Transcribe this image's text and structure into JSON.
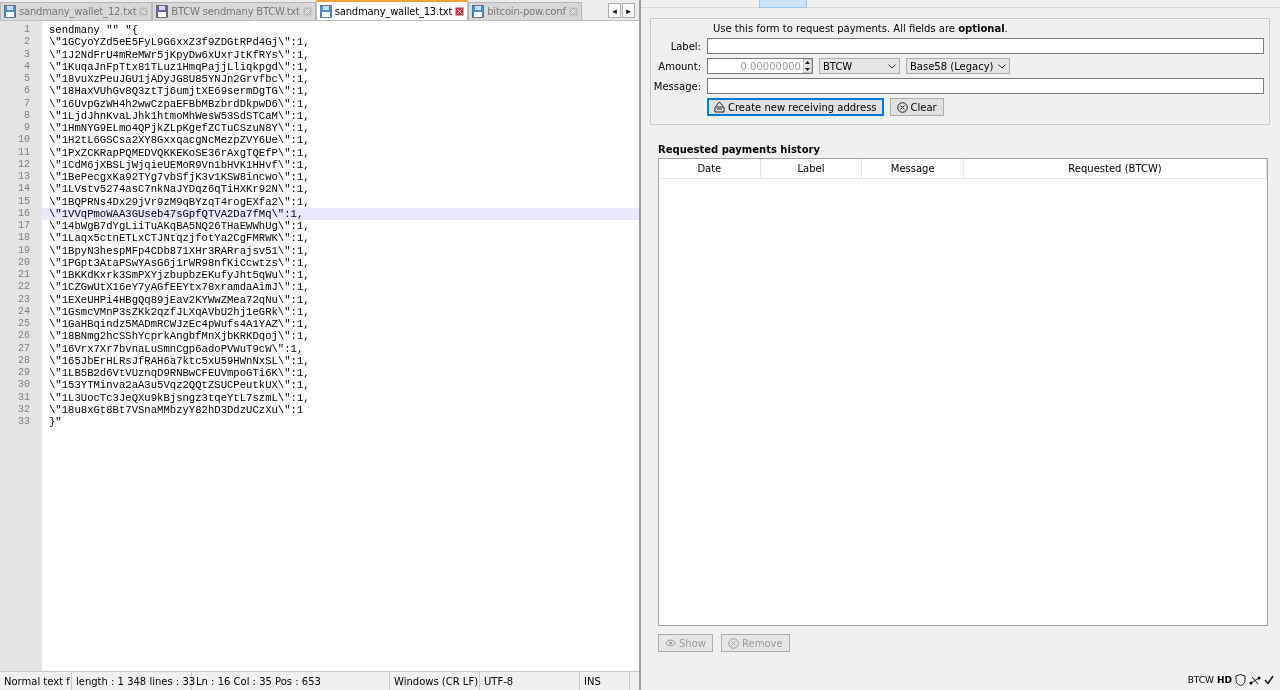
{
  "editor": {
    "tabs": [
      {
        "label": "sandmany_wallet_12.txt",
        "selected": false,
        "kind": "plain"
      },
      {
        "label": "BTCW sendmany BTCW.txt",
        "selected": false,
        "kind": "marked"
      },
      {
        "label": "sandmany_wallet_13.txt",
        "selected": true,
        "kind": "plain"
      },
      {
        "label": "bitcoin-pow.conf",
        "selected": false,
        "kind": "plain"
      }
    ],
    "scroll_buttons": [
      "◂",
      "▸"
    ],
    "lines": [
      {
        "number": "1",
        "text": "sendmany \"\" \"{",
        "selected": false
      },
      {
        "number": "2",
        "text": "\\\"1GCyoYZd5eE5FyL9G6xxZ3f9ZDGtRPd4Gj\\\":1,",
        "selected": false
      },
      {
        "number": "3",
        "text": "\\\"1J2NdFrU4mReMWr5jKpyDw6xUxrJtKfRYs\\\":1,",
        "selected": false
      },
      {
        "number": "4",
        "text": "\\\"1KuqaJnFpTtx81TLuz1HmqPajjLliqkpgd\\\":1,",
        "selected": false
      },
      {
        "number": "5",
        "text": "\\\"18vuXzPeuJGU1jADyJG8U85YNJn2Grvfbc\\\":1,",
        "selected": false
      },
      {
        "number": "6",
        "text": "\\\"18HaxVUhGv8Q3ztTj6umjtXE69sermDgTG\\\":1,",
        "selected": false
      },
      {
        "number": "7",
        "text": "\\\"16UvpGzWH4h2wwCzpaEFBbMBzbrdDkpwD6\\\":1,",
        "selected": false
      },
      {
        "number": "8",
        "text": "\\\"1LjdJhnKvaLJhk1htmoMhWesW53SdSTCaM\\\":1,",
        "selected": false
      },
      {
        "number": "9",
        "text": "\\\"1HmNYG9ELmo4QPjkZLpKgefZCTuCSzuN8Y\\\":1,",
        "selected": false
      },
      {
        "number": "10",
        "text": "\\\"1H2tL6GSCsa2XY8GxxqacgNcMezpZVY6Ue\\\":1,",
        "selected": false
      },
      {
        "number": "11",
        "text": "\\\"1PxZCKRapPQMEDVQKKEKoSE36rAxgTQEfP\\\":1,",
        "selected": false
      },
      {
        "number": "12",
        "text": "\\\"1CdM6jXBSLjWjqieUEMoR9Vn1bHVK1HHvf\\\":1,",
        "selected": false
      },
      {
        "number": "13",
        "text": "\\\"1BePecgxKa92TYg7vbSfjK3v1KSW8incwo\\\":1,",
        "selected": false
      },
      {
        "number": "14",
        "text": "\\\"1LVstv5274asC7nkNaJYDqz6qTiHXKr92N\\\":1,",
        "selected": false
      },
      {
        "number": "15",
        "text": "\\\"1BQPRNs4Dx29jVr9zM9qBYzqT4rogEXfa2\\\":1,",
        "selected": false
      },
      {
        "number": "16",
        "text": "\\\"1VVqPmoWAA3GUseb47sGpfQTVA2Da7fMq\\\":1,",
        "selected": true
      },
      {
        "number": "17",
        "text": "\\\"14bWgB7dYgLiiTuAKqBA5NQ26THaEWWhUg\\\":1,",
        "selected": false
      },
      {
        "number": "18",
        "text": "\\\"1Laqx5ctnETLxCTJNtqzjfotYa2CgFMRWK\\\":1,",
        "selected": false
      },
      {
        "number": "19",
        "text": "\\\"1BpyN3hespMFp4CDb871XHr3RARrajsv51\\\":1,",
        "selected": false
      },
      {
        "number": "20",
        "text": "\\\"1PGpt3AtaPSwYAsG6j1rWR98nfKiCcwtzs\\\":1,",
        "selected": false
      },
      {
        "number": "21",
        "text": "\\\"1BKKdKxrk3SmPXYjzbupbzEKufyJht5qWu\\\":1,",
        "selected": false
      },
      {
        "number": "22",
        "text": "\\\"1CZGwUtX16eY7yAGfEEYtx78xramdaAimJ\\\":1,",
        "selected": false
      },
      {
        "number": "23",
        "text": "\\\"1EXeUHPi4HBgQq89jEav2KYWwZMea72qNu\\\":1,",
        "selected": false
      },
      {
        "number": "24",
        "text": "\\\"1GsmcVMnP3sZKk2qzfJLXqAVbU2hj1eGRk\\\":1,",
        "selected": false
      },
      {
        "number": "25",
        "text": "\\\"1GaHBqindz5MADmRCWJzEc4pWufs4A1YAZ\\\":1,",
        "selected": false
      },
      {
        "number": "26",
        "text": "\\\"18BNmg2hcSShYcprkAngbfMnXjbKRKDqoj\\\":1,",
        "selected": false
      },
      {
        "number": "27",
        "text": "\\\"16Vrx7Xr7bvnaLuSmnCgp6adoPVWuT9cW\\\":1,",
        "selected": false
      },
      {
        "number": "28",
        "text": "\\\"165JbErHLRsJfRAH6a7ktc5xU59HWnNxSL\\\":1,",
        "selected": false
      },
      {
        "number": "29",
        "text": "\\\"1LB5B2d6VtVUznqD9RNBwCFEUVmpoGTi6K\\\":1,",
        "selected": false
      },
      {
        "number": "30",
        "text": "\\\"153YTMinva2aA3u5Vqz2QQtZSUCPeutkUX\\\":1,",
        "selected": false
      },
      {
        "number": "31",
        "text": "\\\"1L3UocTc3JeQXu9kBjsngz3tqeYtL7szmL\\\":1,",
        "selected": false
      },
      {
        "number": "32",
        "text": "\\\"18u8xGt8Bt7VSnaMMbzyY82hD3DdzUCzXu\\\":1",
        "selected": false
      },
      {
        "number": "33",
        "text": "}\"",
        "selected": false
      }
    ],
    "status": [
      "Normal text f",
      "length : 1 348    lines : 33",
      "Ln : 16    Col : 35    Pos : 653",
      "Windows (CR LF)",
      "UTF-8",
      "INS"
    ]
  },
  "wallet": {
    "intro": "Use this form to request payments. All fields are **optional**.",
    "label_field": {
      "label": "Label:"
    },
    "amount_field": {
      "label": "Amount:",
      "value": "0.00000000",
      "unit": "BTCW",
      "address_type": "Base58 (Legacy)"
    },
    "message_field": {
      "label": "Message:"
    },
    "buttons": [
      {
        "label": "Create new receiving address",
        "kind": "create"
      },
      {
        "label": "Clear",
        "kind": "clear"
      }
    ],
    "history_title": "Requested payments history",
    "columns": [
      "Date",
      "Label",
      "Message",
      "Requested (BTCW)"
    ],
    "history_buttons": [
      {
        "label": "Show",
        "kind": "show",
        "disabled": true
      },
      {
        "label": "Remove",
        "kind": "remove",
        "disabled": true
      }
    ],
    "status": {
      "unit": "BTCW",
      "hd": "HD"
    }
  }
}
